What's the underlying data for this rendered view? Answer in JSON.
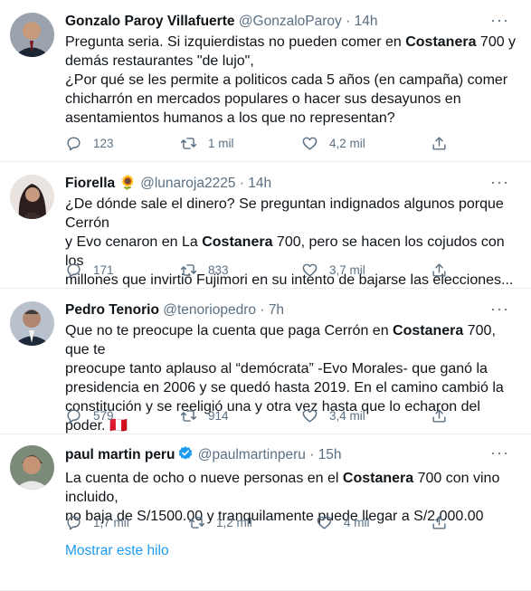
{
  "tweets": [
    {
      "name": "Gonzalo Paroy Villafuerte",
      "handle": "@GonzaloParoy",
      "time": "14h",
      "lines": [
        {
          "pre": "Pregunta seria. Si izquierdistas no pueden comer en ",
          "bold": "Costanera",
          "post": " 700 y"
        },
        {
          "pre": "demás restaurantes \"de lujo\",",
          "bold": "",
          "post": ""
        },
        {
          "pre": "¿Por qué se les permite a politicos cada 5 años (en campaña) comer",
          "bold": "",
          "post": ""
        },
        {
          "pre": "chicharrón en mercados populares o hacer sus desayunos en",
          "bold": "",
          "post": ""
        },
        {
          "pre": "asentamientos humanos a los que no representan?",
          "bold": "",
          "post": ""
        }
      ],
      "replies": "123",
      "retweets": "1 mil",
      "likes": "4,2 mil"
    },
    {
      "name": "Fiorella",
      "name_emoji": "🌻",
      "handle": "@lunaroja2225",
      "time": "14h",
      "lines": [
        {
          "pre": "¿De dónde sale el dinero?  Se preguntan indignados algunos porque Cerrón",
          "bold": "",
          "post": ""
        },
        {
          "pre": "y Evo cenaron en La ",
          "bold": "Costanera",
          "post": " 700, pero se hacen los cojudos con los"
        },
        {
          "pre": "millones que invirtió Fujimori en su intento de bajarse las elecciones...",
          "bold": "",
          "post": ""
        }
      ],
      "replies": "171",
      "retweets": "833",
      "likes": "3,7 mil"
    },
    {
      "name": "Pedro Tenorio",
      "handle": "@tenoriopedro",
      "time": "7h",
      "lines": [
        {
          "pre": "Que no te preocupe la cuenta que paga Cerrón en ",
          "bold": "Costanera",
          "post": " 700, que te"
        },
        {
          "pre": "preocupe tanto aplauso al “demócrata” -Evo Morales- que ganó la",
          "bold": "",
          "post": ""
        },
        {
          "pre": "presidencia en 2006 y se quedó hasta 2019. En el camino cambió la",
          "bold": "",
          "post": ""
        },
        {
          "pre": "constitución y se reeligió una y otra vez hasta que lo echaron del poder.",
          "bold": "",
          "post": ""
        }
      ],
      "flag": "🇵🇪",
      "replies": "579",
      "retweets": "914",
      "likes": "3,4 mil"
    },
    {
      "name": "paul martin peru",
      "handle": "@paulmartinperu",
      "time": "15h",
      "verified": true,
      "lines": [
        {
          "pre": "La cuenta de ocho o nueve personas en el ",
          "bold": "Costanera",
          "post": " 700 con vino incluido,"
        },
        {
          "pre": "no baja de S/1500.00 y tranquilamente puede llegar a S/2,000.00",
          "bold": "",
          "post": ""
        }
      ],
      "replies": "1,7 mil",
      "retweets": "1,2 mil",
      "likes": "4 mil"
    }
  ],
  "show_thread": "Mostrar este hilo",
  "separator": "·",
  "colors": {
    "text": "#0f1419",
    "muted": "#5b7083",
    "link": "#1d9bf0",
    "verified": "#1d9bf0",
    "border": "#ebeef0"
  }
}
